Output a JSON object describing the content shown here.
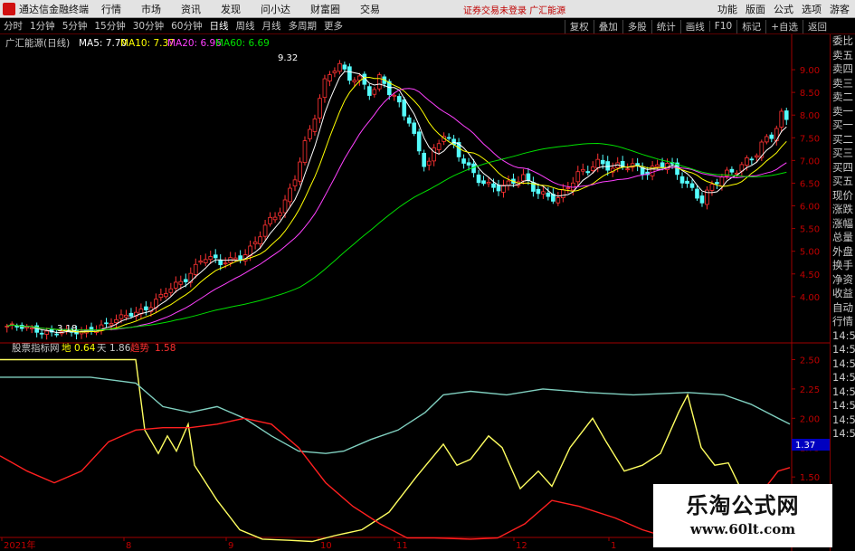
{
  "topbar": {
    "title": "通达信金融终端",
    "menus": [
      "行情",
      "市场",
      "资讯",
      "发现",
      "问小达",
      "财富圈",
      "交易"
    ],
    "notice": "证券交易未登录   广汇能源",
    "right": [
      "功能",
      "版面",
      "公式",
      "选项",
      "游客"
    ]
  },
  "toolbar": {
    "periods": [
      "分时",
      "1分钟",
      "5分钟",
      "15分钟",
      "30分钟",
      "60分钟",
      "日线",
      "周线",
      "月线",
      "多周期",
      "更多"
    ],
    "active_period": "日线",
    "tools": [
      "复权",
      "叠加",
      "多股",
      "统计",
      "画线",
      "F10",
      "标记",
      "+自选",
      "返回"
    ]
  },
  "main": {
    "stock_name": "广汇能源(日线)",
    "ma": [
      {
        "label": "MA5: 7.70",
        "color": "#ffffff"
      },
      {
        "label": "MA10: 7.37",
        "color": "#ffff00"
      },
      {
        "label": "MA20: 6.96",
        "color": "#ff40ff"
      },
      {
        "label": "MA60: 6.69",
        "color": "#00e000"
      }
    ],
    "high_label": "9.32",
    "low_label": "3.18",
    "y_ticks": [
      "9.00",
      "8.50",
      "8.00",
      "7.50",
      "7.00",
      "6.50",
      "6.00",
      "5.50",
      "5.00",
      "4.50",
      "4.00"
    ]
  },
  "indicator": {
    "name": "股票指标网",
    "items": [
      {
        "label": "地",
        "value": "0.64",
        "color": "#ffff00"
      },
      {
        "label": "天",
        "value": "1.86",
        "color": "#c8c8c8"
      },
      {
        "label": "趋势",
        "value": "1.58",
        "color": "#ff3030"
      }
    ],
    "y_ticks": [
      "2.50",
      "2.25",
      "2.00",
      "1.75",
      "1.50",
      "1.25"
    ],
    "current_value": "1.37"
  },
  "x_axis": [
    "2021年",
    "8",
    "9",
    "10",
    "11",
    "12",
    "1"
  ],
  "side": [
    "委比",
    "卖五",
    "卖四",
    "卖三",
    "卖二",
    "卖一",
    "买一",
    "买二",
    "买三",
    "买四",
    "买五",
    "现价",
    "涨跌",
    "涨幅",
    "总量",
    "外盘",
    "换手",
    "净资",
    "收益",
    "自动",
    "行情",
    "14:56",
    "14:56",
    "14:56",
    "14:56",
    "14:56",
    "14:56",
    "14:56",
    "14:56"
  ],
  "watermark": {
    "line1": "乐淘公式网",
    "line2": "www.60lt.com"
  },
  "colors": {
    "up": "#ff3232",
    "down": "#54fcfc",
    "ma5": "#ffffff",
    "ma10": "#ffff00",
    "ma20": "#ff40ff",
    "ma60": "#00e000",
    "ind_yellow": "#ffff60",
    "ind_cyan": "#80d0c0",
    "ind_red": "#ff2020",
    "axis": "#a00000"
  }
}
